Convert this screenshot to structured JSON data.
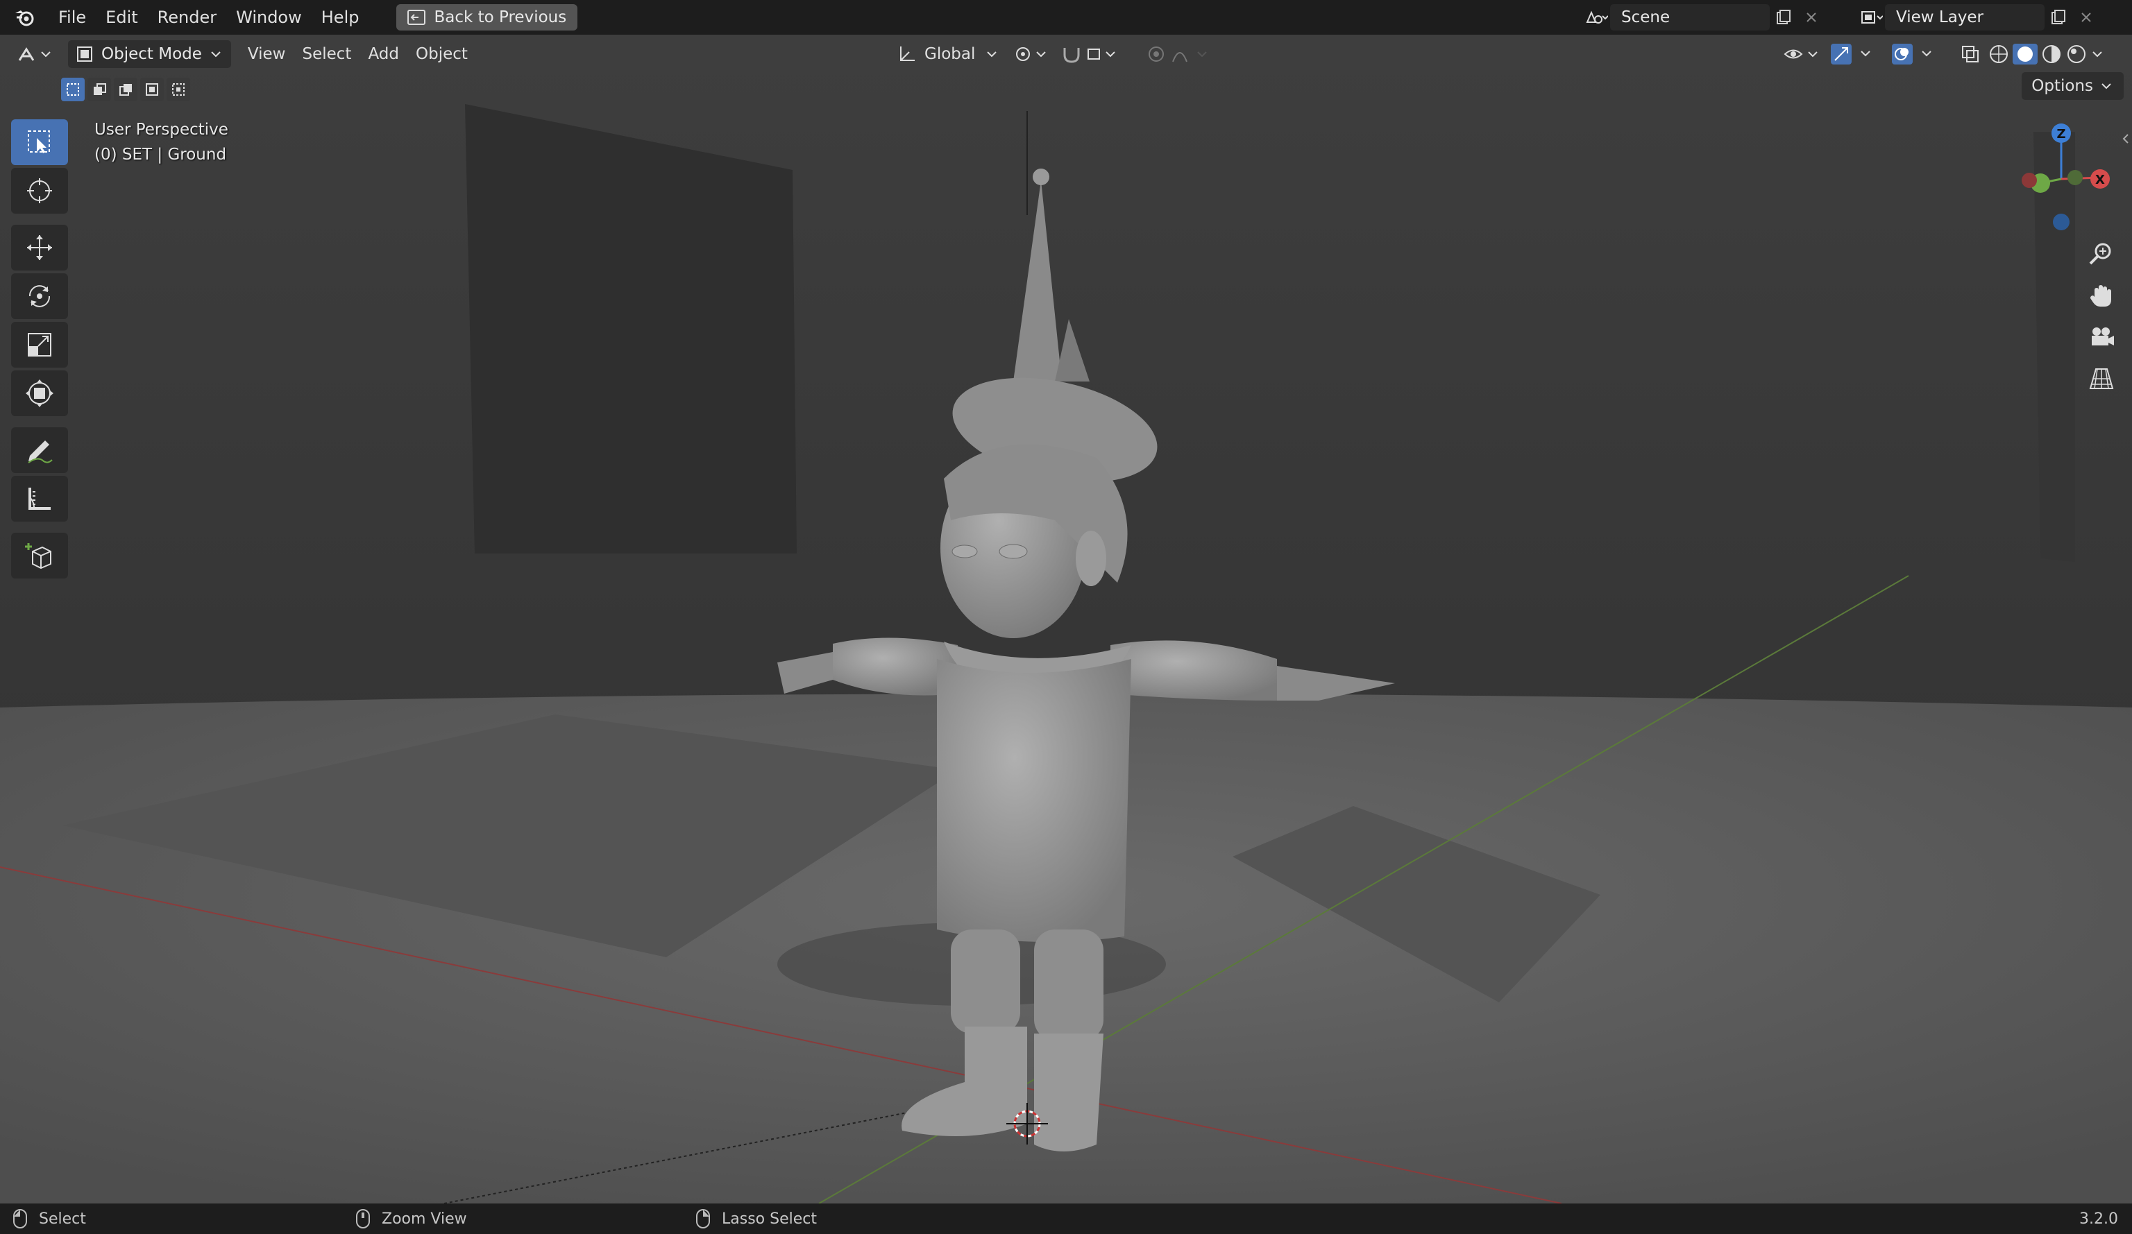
{
  "menu": {
    "items": [
      "File",
      "Edit",
      "Render",
      "Window",
      "Help"
    ],
    "back_button": "Back to Previous"
  },
  "scene": {
    "name": "Scene",
    "view_layer": "View Layer"
  },
  "viewport_header": {
    "mode": "Object Mode",
    "menus": [
      "View",
      "Select",
      "Add",
      "Object"
    ],
    "orientation": "Global",
    "options": "Options"
  },
  "viewport": {
    "perspective_label": "User Perspective",
    "object_label": "(0) SET | Ground"
  },
  "gizmo": {
    "z": "Z",
    "x": "X",
    "colors": {
      "x": "#d64c4c",
      "y": "#6ea846",
      "z": "#3d7fd6"
    }
  },
  "statusbar": {
    "select": "Select",
    "zoom": "Zoom View",
    "lasso": "Lasso Select",
    "version": "3.2.0"
  },
  "colors": {
    "accent": "#4772b3",
    "header": "#1d1d1d",
    "viewport_bg": "#3d3d3d"
  }
}
